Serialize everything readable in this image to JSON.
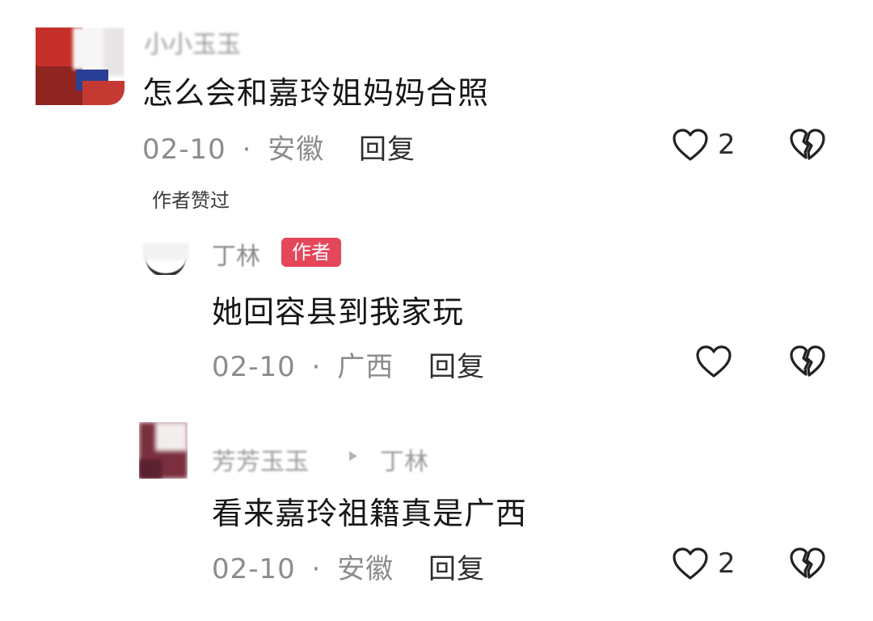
{
  "comments": [
    {
      "username": "小小玉玉",
      "text": "怎么会和嘉玲姐妈妈合照",
      "date": "02-10",
      "location": "安徽",
      "reply_label": "回复",
      "likes": "2",
      "author_liked": "作者赞过"
    },
    {
      "username": "丁林",
      "author_badge": "作者",
      "text": "她回容县到我家玩",
      "date": "02-10",
      "location": "广西",
      "reply_label": "回复",
      "likes": ""
    },
    {
      "username": "芳芳玉玉",
      "reply_to": "丁林",
      "text": "看来嘉玲祖籍真是广西",
      "date": "02-10",
      "location": "安徽",
      "reply_label": "回复",
      "likes": "2"
    }
  ],
  "meta_separator": "·",
  "icons": {
    "like": "heart-outline-icon",
    "dislike": "broken-heart-icon",
    "reply_arrow": "triangle-right-icon"
  },
  "colors": {
    "author_badge_bg": "#e4465a",
    "meta_text": "#8c8c8c",
    "comment_text": "#161616"
  }
}
